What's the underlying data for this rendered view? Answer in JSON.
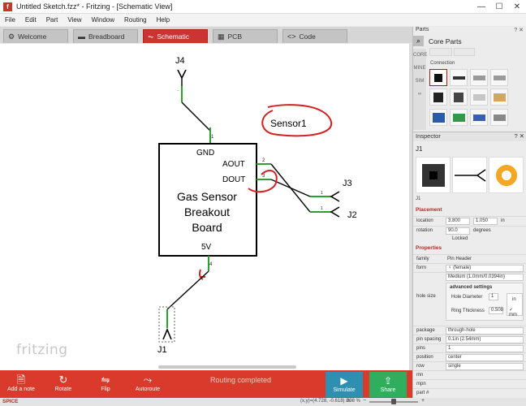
{
  "window": {
    "title": "Untitled Sketch.fzz* - Fritzing - [Schematic View]",
    "controls": [
      "—",
      "☐",
      "✕"
    ]
  },
  "menu": [
    "File",
    "Edit",
    "Part",
    "View",
    "Window",
    "Routing",
    "Help"
  ],
  "tabs": [
    {
      "label": "Welcome",
      "icon": "gear-icon"
    },
    {
      "label": "Breadboard",
      "icon": "breadboard-icon"
    },
    {
      "label": "Schematic",
      "icon": "schematic-icon"
    },
    {
      "label": "PCB",
      "icon": "pcb-icon"
    },
    {
      "label": "Code",
      "icon": "code-icon"
    }
  ],
  "schematic": {
    "chip_label": [
      "Gas Sensor",
      "Breakout",
      "Board"
    ],
    "pin_gnd": "GND",
    "pin_aout": "AOUT",
    "pin_dout": "DOUT",
    "pin_5v": "5V",
    "pin_num_1": "1",
    "pin_num_2": "2",
    "pin_num_3": "3",
    "pin_num_4": "4",
    "j4": "J4",
    "j3": "J3",
    "j2": "J2",
    "j1": "J1",
    "j3_pin": "1",
    "j2_pin": "1",
    "annotation": "Sensor1"
  },
  "logo": "fritzing",
  "toolbar": {
    "add_note": "Add a note",
    "rotate": "Rotate",
    "flip": "Flip",
    "autoroute": "Autoroute",
    "routing_status": "Routing completed",
    "simulate": "Simulate",
    "share": "Share"
  },
  "statusbar": {
    "coords": "(x,y)=(4.728, -0.618) in",
    "zoom": "398 %"
  },
  "parts_panel": {
    "header": "Parts",
    "title": "Core Parts",
    "connection_label": "Connection",
    "bins": [
      "CORE",
      "MINE",
      "SIM",
      "∞"
    ]
  },
  "inspector": {
    "header": "Inspector",
    "title": "J1",
    "subtitle": "J1",
    "placement_label": "Placement",
    "location_label": "location",
    "location_x": "3.800",
    "location_y": "1.050",
    "location_unit": "in",
    "rotation_label": "rotation",
    "rotation_value": "90.0",
    "rotation_unit": "degrees",
    "locked_label": "Locked",
    "properties_label": "Properties",
    "props": [
      {
        "key": "family",
        "value": "Pin Header"
      },
      {
        "key": "form",
        "value": "♀ (female)"
      },
      {
        "key": "",
        "value": "Medium (1.0mm/0.0394in)"
      }
    ],
    "hole_size_label": "hole size",
    "advanced_label": "advanced settings",
    "hole_diameter_label": "Hole Diameter",
    "hole_diameter_value": "1",
    "ring_thickness_label": "Ring Thickness",
    "ring_thickness_value": "0.508",
    "unit_in": "in",
    "unit_mm": "mm",
    "props2": [
      {
        "key": "package",
        "value": "through-hole"
      },
      {
        "key": "pin spacing",
        "value": "0.1in (2.54mm)"
      },
      {
        "key": "pins",
        "value": "1"
      },
      {
        "key": "position",
        "value": "center"
      },
      {
        "key": "row",
        "value": "single"
      },
      {
        "key": "mn",
        "value": ""
      },
      {
        "key": "mpn",
        "value": ""
      },
      {
        "key": "part #",
        "value": ""
      }
    ],
    "spice_label": "SPICE"
  }
}
